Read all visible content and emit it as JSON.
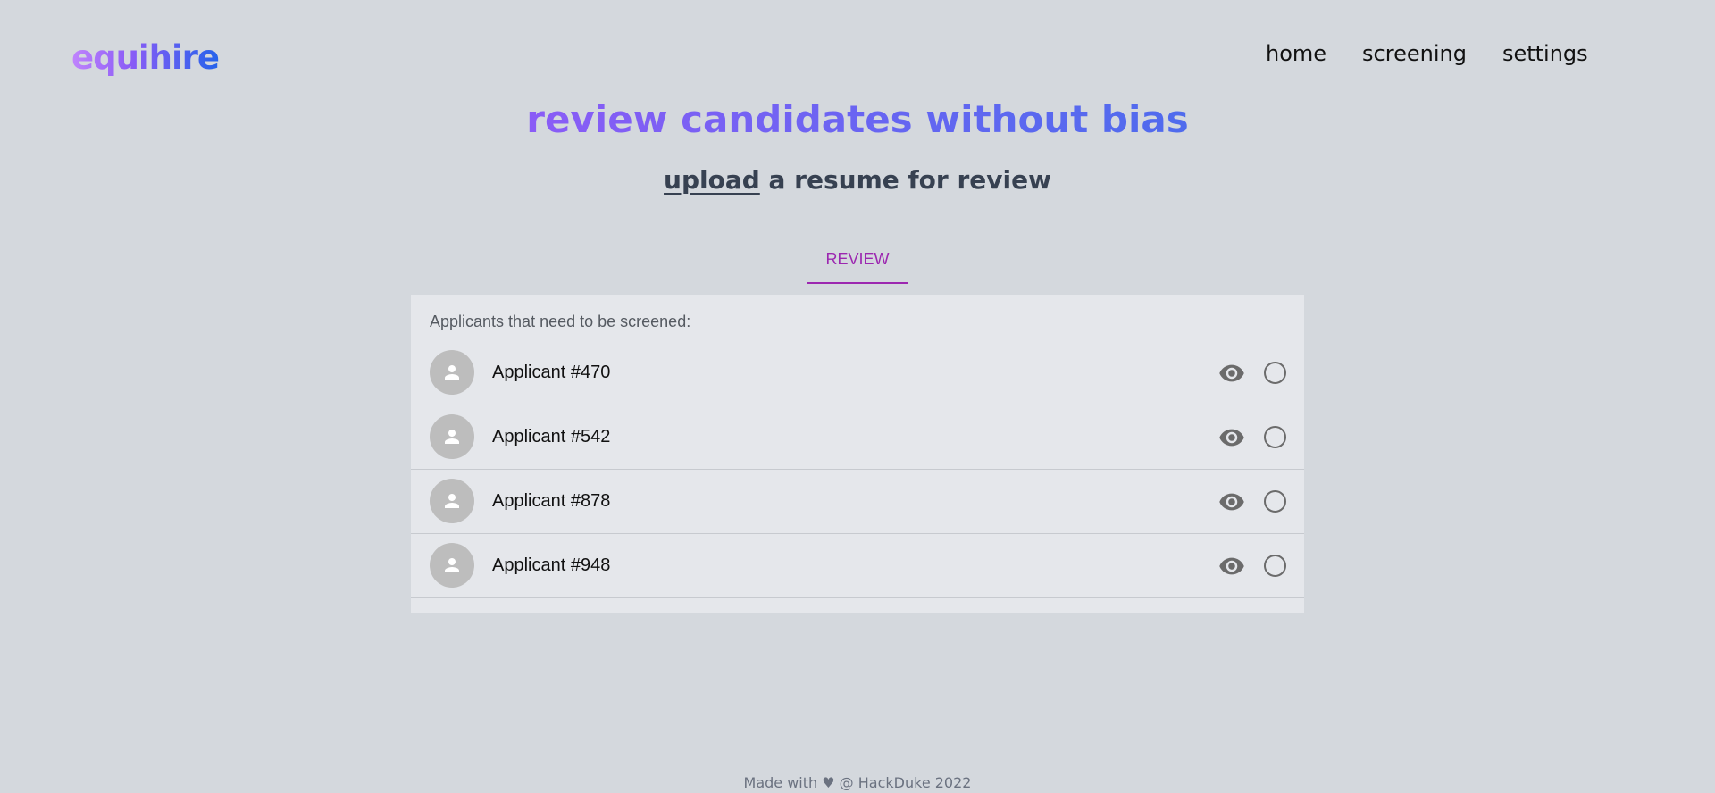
{
  "brand": {
    "logo": "equihire"
  },
  "nav": {
    "items": [
      {
        "label": "home"
      },
      {
        "label": "screening"
      },
      {
        "label": "settings"
      }
    ]
  },
  "hero": {
    "title": "review candidates without bias",
    "subtitle_link": "upload",
    "subtitle_rest": " a resume for review"
  },
  "tabs": [
    {
      "label": "REVIEW",
      "active": true
    }
  ],
  "panel": {
    "header": "Applicants that need to be screened:",
    "rows": [
      {
        "label": "Applicant #470",
        "avatar_icon": "person-icon",
        "view_icon": "eye-icon",
        "selected": false
      },
      {
        "label": "Applicant #542",
        "avatar_icon": "person-icon",
        "view_icon": "eye-icon",
        "selected": false
      },
      {
        "label": "Applicant #878",
        "avatar_icon": "person-icon",
        "view_icon": "eye-icon",
        "selected": false
      },
      {
        "label": "Applicant #948",
        "avatar_icon": "person-icon",
        "view_icon": "eye-icon",
        "selected": false
      }
    ]
  },
  "footer": {
    "text": "Made with ♥ @ HackDuke 2022"
  },
  "colors": {
    "background": "#d4d8dd",
    "panel": "#e5e7eb",
    "accent_tab": "#9c27b0",
    "title_gradient_start": "#8b5cf6",
    "title_gradient_end": "#4f6bed",
    "logo_gradient_start": "#c084fc",
    "logo_gradient_end": "#2563eb"
  }
}
